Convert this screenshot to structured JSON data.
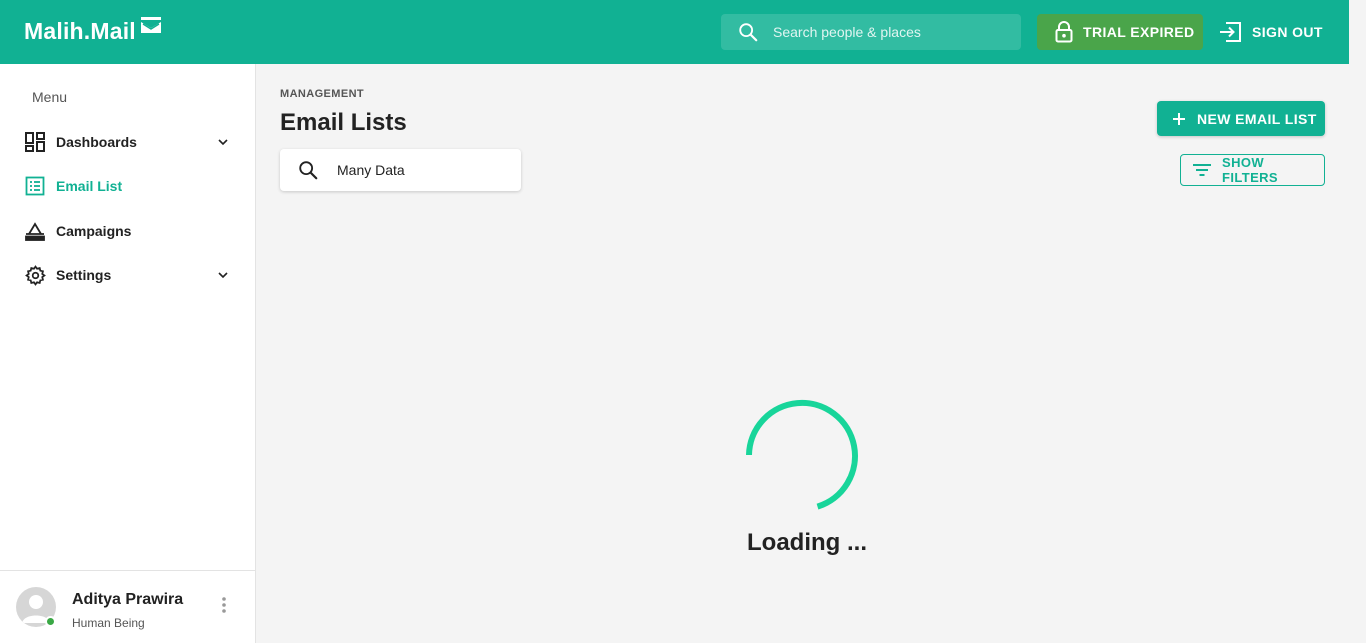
{
  "header": {
    "brand": "Malih.Mail",
    "search_placeholder": "Search people & places",
    "trial_label": "TRIAL EXPIRED",
    "signout_label": "SIGN OUT",
    "accent_color": "#11b193"
  },
  "sidebar": {
    "heading": "Menu",
    "items": [
      {
        "label": "Dashboards",
        "icon": "dashboard-icon",
        "expandable": true,
        "active": false
      },
      {
        "label": "Email List",
        "icon": "list-icon",
        "expandable": false,
        "active": true
      },
      {
        "label": "Campaigns",
        "icon": "campaign-icon",
        "expandable": false,
        "active": false
      },
      {
        "label": "Settings",
        "icon": "gear-icon",
        "expandable": true,
        "active": false
      }
    ],
    "user": {
      "name": "Aditya Prawira",
      "role": "Human Being",
      "status": "online"
    }
  },
  "main": {
    "eyebrow": "MANAGEMENT",
    "title": "Email Lists",
    "new_button": "NEW EMAIL LIST",
    "search_value": "Many Data",
    "filters_button": "SHOW FILTERS",
    "loading_text": "Loading ..."
  }
}
